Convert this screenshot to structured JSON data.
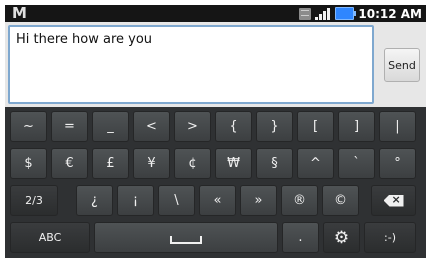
{
  "status_bar": {
    "app_icon": "gmail-icon",
    "icons": [
      "sim-icon",
      "signal-icon",
      "battery-icon"
    ],
    "time": "10:12 AM"
  },
  "compose": {
    "message_text": "Hi there how are you",
    "send_label": "Send"
  },
  "keyboard": {
    "rows": [
      [
        "~",
        "=",
        "_",
        "<",
        ">",
        "{",
        "}",
        "[",
        "]",
        "|"
      ],
      [
        "$",
        "€",
        "£",
        "¥",
        "¢",
        "₩",
        "§",
        "^",
        "`",
        "°"
      ],
      [
        "2/3",
        "¿",
        "¡",
        "\\",
        "«",
        "»",
        "®",
        "©"
      ],
      [
        "ABC",
        ".",
        ":-)"
      ]
    ],
    "icons": {
      "backspace": "backspace-icon",
      "space": "space-icon",
      "settings": "gear-icon"
    }
  },
  "colors": {
    "status_bar_bg": "#151515",
    "keyboard_bg": "#2f3133",
    "text_field_border": "#7fa8cf",
    "battery": "#2f86ff"
  }
}
